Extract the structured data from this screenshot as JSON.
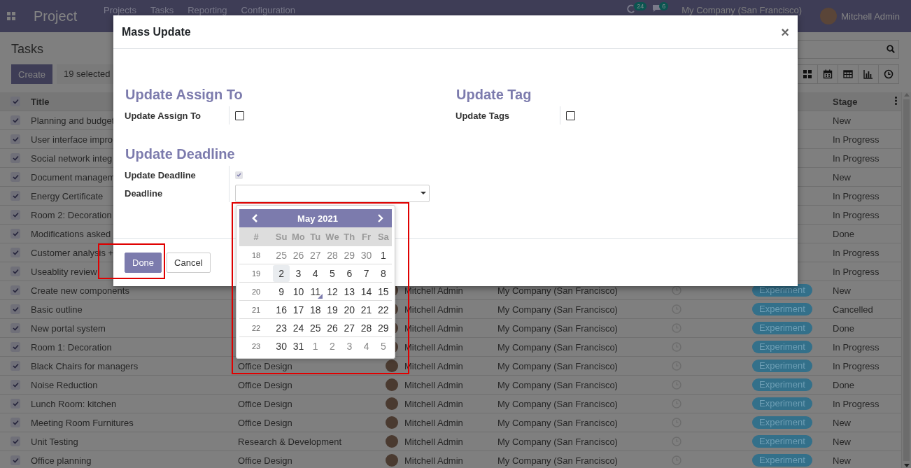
{
  "navbar": {
    "app_title": "Project",
    "menu": [
      "Projects",
      "Tasks",
      "Reporting",
      "Configuration"
    ],
    "activity_count": "24",
    "message_count": "6",
    "company": "My Company (San Francisco)",
    "user": "Mitchell Admin"
  },
  "control_panel": {
    "title": "Tasks",
    "create_button": "Create",
    "selection_count": "19 selected",
    "views": [
      {
        "kind": "kanban"
      },
      {
        "kind": "calendar"
      },
      {
        "kind": "list"
      },
      {
        "kind": "graph"
      },
      {
        "kind": "activity"
      }
    ]
  },
  "table": {
    "header": {
      "checked": true,
      "title_column": "Title",
      "stage_column": "Stage"
    },
    "rows": [
      {
        "checked": true,
        "title": "Planning and budget",
        "stage": "New"
      },
      {
        "checked": true,
        "title": "User interface impro",
        "stage": "In Progress"
      },
      {
        "checked": true,
        "title": "Social network integ",
        "stage": "In Progress"
      },
      {
        "checked": true,
        "title": "Document managem",
        "stage": "New"
      },
      {
        "checked": true,
        "title": "Energy Certificate",
        "stage": "In Progress"
      },
      {
        "checked": true,
        "title": "Room 2: Decoration",
        "stage": "In Progress"
      },
      {
        "checked": true,
        "title": "Modifications asked",
        "stage": "Done"
      },
      {
        "checked": true,
        "title": "Customer analysis +",
        "stage": "In Progress"
      },
      {
        "checked": true,
        "title": "Useablity review",
        "stage": "In Progress"
      },
      {
        "checked": true,
        "title": "Create new components",
        "assignee": "Mitchell Admin",
        "company": "My Company (San Francisco)",
        "tag": "Experiment",
        "stage": "New"
      },
      {
        "checked": true,
        "title": "Basic outline",
        "assignee": "Mitchell Admin",
        "company": "My Company (San Francisco)",
        "tag": "Experiment",
        "stage": "Cancelled"
      },
      {
        "checked": true,
        "title": "New portal system",
        "assignee": "Mitchell Admin",
        "company": "My Company (San Francisco)",
        "tag": "Experiment",
        "stage": "Done"
      },
      {
        "checked": true,
        "title": "Room 1: Decoration",
        "assignee": "Mitchell Admin",
        "company": "My Company (San Francisco)",
        "tag": "Experiment",
        "stage": "In Progress"
      },
      {
        "checked": true,
        "title": "Black Chairs for managers",
        "project": "Office Design",
        "assignee": "Mitchell Admin",
        "company": "My Company (San Francisco)",
        "tag": "Experiment",
        "stage": "In Progress"
      },
      {
        "checked": true,
        "title": "Noise Reduction",
        "project": "Office Design",
        "assignee": "Mitchell Admin",
        "company": "My Company (San Francisco)",
        "tag": "Experiment",
        "stage": "Done"
      },
      {
        "checked": true,
        "title": "Lunch Room: kitchen",
        "project": "Office Design",
        "assignee": "Mitchell Admin",
        "company": "My Company (San Francisco)",
        "tag": "Experiment",
        "stage": "In Progress"
      },
      {
        "checked": true,
        "title": "Meeting Room Furnitures",
        "project": "Office Design",
        "assignee": "Mitchell Admin",
        "company": "My Company (San Francisco)",
        "tag": "Experiment",
        "stage": "New"
      },
      {
        "checked": true,
        "title": "Unit Testing",
        "project": "Research & Development",
        "assignee": "Mitchell Admin",
        "company": "My Company (San Francisco)",
        "tag": "Experiment",
        "stage": "New"
      },
      {
        "checked": true,
        "title": "Office planning",
        "project": "Office Design",
        "assignee": "Mitchell Admin",
        "company": "My Company (San Francisco)",
        "tag": "Experiment",
        "stage": "New"
      }
    ]
  },
  "dialog": {
    "title": "Mass Update",
    "close": "×",
    "groups": [
      {
        "heading": "Update Assign To",
        "fields": [
          {
            "kind": "checkbox",
            "label": "Update Assign To",
            "checked": false
          }
        ]
      },
      {
        "heading": "Update Tag",
        "fields": [
          {
            "kind": "checkbox",
            "label": "Update Tags",
            "checked": false
          }
        ]
      },
      {
        "heading": "Update Deadline",
        "fields": [
          {
            "kind": "checkbox",
            "label": "Update Deadline",
            "checked": true
          },
          {
            "kind": "date",
            "label": "Deadline"
          }
        ]
      }
    ],
    "buttons": [
      {
        "label": "Done",
        "kind": "primary"
      },
      {
        "label": "Cancel",
        "kind": "secondary"
      }
    ],
    "datepicker": {
      "month": "May 2021",
      "week_label": "#",
      "weekdays": [
        "Su",
        "Mo",
        "Tu",
        "We",
        "Th",
        "Fr",
        "Sa"
      ],
      "weeks": [
        {
          "number": "18",
          "days": [
            {
              "label": "25",
              "muted": true,
              "selected": false,
              "today": false
            },
            {
              "label": "26",
              "muted": true,
              "selected": false,
              "today": false
            },
            {
              "label": "27",
              "muted": true,
              "selected": false,
              "today": false
            },
            {
              "label": "28",
              "muted": true,
              "selected": false,
              "today": false
            },
            {
              "label": "29",
              "muted": true,
              "selected": false,
              "today": false
            },
            {
              "label": "30",
              "muted": true,
              "selected": false,
              "today": false
            },
            {
              "label": "1",
              "muted": false,
              "selected": false,
              "today": false
            }
          ]
        },
        {
          "number": "19",
          "days": [
            {
              "label": "2",
              "muted": false,
              "selected": true,
              "today": false
            },
            {
              "label": "3",
              "muted": false,
              "selected": false,
              "today": false
            },
            {
              "label": "4",
              "muted": false,
              "selected": false,
              "today": false
            },
            {
              "label": "5",
              "muted": false,
              "selected": false,
              "today": false
            },
            {
              "label": "6",
              "muted": false,
              "selected": false,
              "today": false
            },
            {
              "label": "7",
              "muted": false,
              "selected": false,
              "today": false
            },
            {
              "label": "8",
              "muted": false,
              "selected": false,
              "today": false
            }
          ]
        },
        {
          "number": "20",
          "days": [
            {
              "label": "9",
              "muted": false,
              "selected": false,
              "today": false
            },
            {
              "label": "10",
              "muted": false,
              "selected": false,
              "today": false
            },
            {
              "label": "11",
              "muted": false,
              "selected": false,
              "today": true
            },
            {
              "label": "12",
              "muted": false,
              "selected": false,
              "today": false
            },
            {
              "label": "13",
              "muted": false,
              "selected": false,
              "today": false
            },
            {
              "label": "14",
              "muted": false,
              "selected": false,
              "today": false
            },
            {
              "label": "15",
              "muted": false,
              "selected": false,
              "today": false
            }
          ]
        },
        {
          "number": "21",
          "days": [
            {
              "label": "16",
              "muted": false,
              "selected": false,
              "today": false
            },
            {
              "label": "17",
              "muted": false,
              "selected": false,
              "today": false
            },
            {
              "label": "18",
              "muted": false,
              "selected": false,
              "today": false
            },
            {
              "label": "19",
              "muted": false,
              "selected": false,
              "today": false
            },
            {
              "label": "20",
              "muted": false,
              "selected": false,
              "today": false
            },
            {
              "label": "21",
              "muted": false,
              "selected": false,
              "today": false
            },
            {
              "label": "22",
              "muted": false,
              "selected": false,
              "today": false
            }
          ]
        },
        {
          "number": "22",
          "days": [
            {
              "label": "23",
              "muted": false,
              "selected": false,
              "today": false
            },
            {
              "label": "24",
              "muted": false,
              "selected": false,
              "today": false
            },
            {
              "label": "25",
              "muted": false,
              "selected": false,
              "today": false
            },
            {
              "label": "26",
              "muted": false,
              "selected": false,
              "today": false
            },
            {
              "label": "27",
              "muted": false,
              "selected": false,
              "today": false
            },
            {
              "label": "28",
              "muted": false,
              "selected": false,
              "today": false
            },
            {
              "label": "29",
              "muted": false,
              "selected": false,
              "today": false
            }
          ]
        },
        {
          "number": "23",
          "days": [
            {
              "label": "30",
              "muted": false,
              "selected": false,
              "today": false
            },
            {
              "label": "31",
              "muted": false,
              "selected": false,
              "today": false
            },
            {
              "label": "1",
              "muted": true,
              "selected": false,
              "today": false
            },
            {
              "label": "2",
              "muted": true,
              "selected": false,
              "today": false
            },
            {
              "label": "3",
              "muted": true,
              "selected": false,
              "today": false
            },
            {
              "label": "4",
              "muted": true,
              "selected": false,
              "today": false
            },
            {
              "label": "5",
              "muted": true,
              "selected": false,
              "today": false
            }
          ]
        }
      ]
    }
  }
}
